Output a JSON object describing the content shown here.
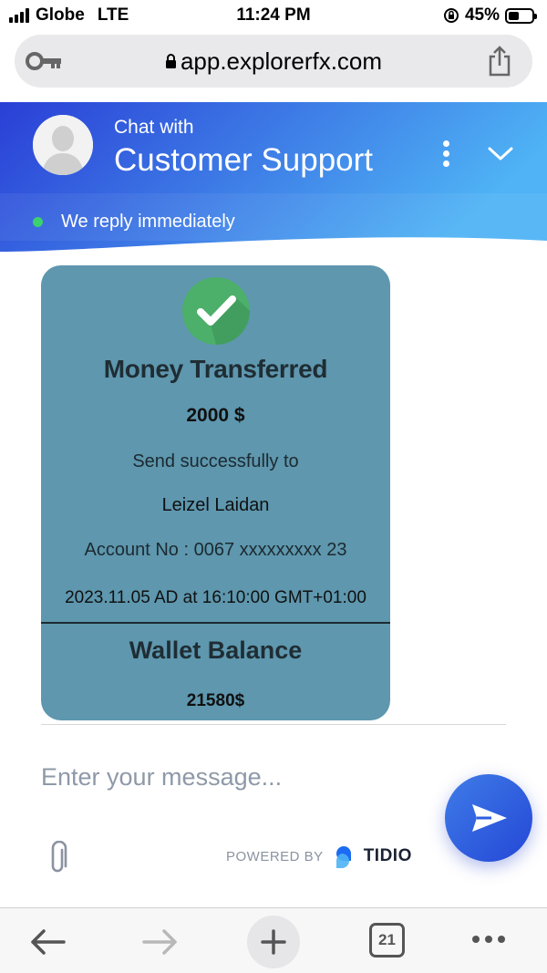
{
  "status_bar": {
    "carrier": "Globe",
    "network": "LTE",
    "time": "11:24 PM",
    "battery_percent": "45%",
    "battery_level": 0.45
  },
  "url_bar": {
    "url": "app.explorerfx.com",
    "key_icon": "key-icon",
    "share_icon": "share-icon"
  },
  "chat_header": {
    "subtitle": "Chat with",
    "title": "Customer Support",
    "status": "We reply immediately",
    "colors": {
      "gradient_start": "#2a3fd6",
      "gradient_end": "#4fb3f5",
      "status_dot": "#3bd16f"
    }
  },
  "message_card": {
    "title": "Money Transferred",
    "amount": "2000 $",
    "send_text": "Send successfully to",
    "recipient": "Leizel Laidan",
    "account": "Account No : 0067 xxxxxxxxx 23",
    "datetime": "2023.11.05 AD at 16:10:00 GMT+01:00",
    "wallet_label": "Wallet Balance",
    "wallet_balance": "21580$",
    "colors": {
      "card_bg": "#5e97ae",
      "check_green": "#4caf6a"
    }
  },
  "composer": {
    "placeholder": "Enter your message...",
    "powered_by": "POWERED BY",
    "brand": "TIDIO",
    "colors": {
      "send_button": "#2f5ee0"
    }
  },
  "toolbar": {
    "tab_count": "21"
  }
}
